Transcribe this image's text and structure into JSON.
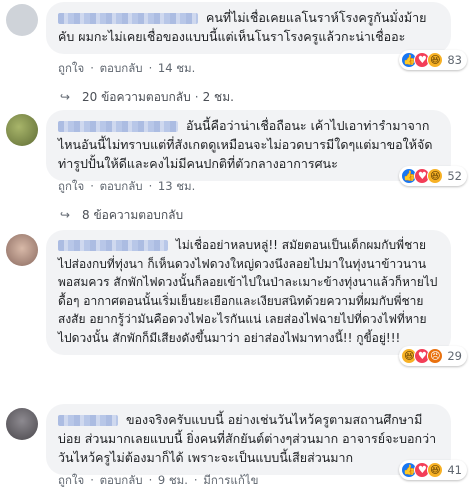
{
  "comments": [
    {
      "text": "คนที่ไม่เชื่อเคยแลโนราห์โรงครูกันมั่งม้ายคับ ผมกะไม่เคยเชื่อของแบบนี้แต่เห็นโนราโรงครูแล้วกะน่าเชื่ออะ",
      "like_label": "ถูกใจ",
      "reply_label": "ตอบกลับ",
      "time": "14 ชม.",
      "reactions": [
        "like",
        "love",
        "haha"
      ],
      "reaction_count": "83",
      "replies": "20 ข้อความตอบกลับ",
      "replies_time": "2 ชม.",
      "avatar_color": "#cfd3d9"
    },
    {
      "text": "อันนี้คือว่าน่าเชื่อถือนะ เค้าไปเอาท่ารำมาจากไหนอันนี้ไม่ทราบแต่ที่สังเกตดูเหมือนจะไม่อวดบารมีใดๆแต่มาขอให้จัดท่ารูปปั้นให้ดีและคงไม่มีคนปกติที่ตัวกลางอาการศนะ",
      "like_label": "ถูกใจ",
      "reply_label": "ตอบกลับ",
      "time": "13 ชม.",
      "reactions": [
        "like",
        "love",
        "haha"
      ],
      "reaction_count": "52",
      "replies": "8 ข้อความตอบกลับ",
      "avatar_color": "#7d8a4e"
    },
    {
      "text": "ไม่เชื่ออย่าหลบหลู่!! สมัยตอนเป็นเด็กผมกับพี่ชาย ไปส่องกบที่ทุ่งนา ก็เห็นดวงไฟดวงใหญ่ดวงนึงลอยไปมาในทุ่งนาข้าวนานพอสมควร สักพักไฟดวงนั้นก็ลอยเข้าไปในป่าละเมาะข้างทุ่งนาแล้วก็หายไปดื้อๆ อากาศตอนนั้นเริ่มเย็นยะเยือกและเงียบสนิทด้วยความที่ผมกับพี่ชายสงสัย อยากรู้ว่ามันคือดวงไฟอะไรกันแน่ เลยส่องไฟฉายไปที่ดวงไฟที่หายไปดวงนั้น สักพักก็มีเสียงดังขึ้นมาว่า อย่าส่องไฟมาทางนี้!! กูขี้อยู่!!!",
      "reactions": [
        "haha",
        "love",
        "angry"
      ],
      "reaction_count": "29",
      "avatar_color": "#b79a8e"
    },
    {
      "text": "ของจริงครับแบบนี้ อย่างเช่นวันไหว้ครูตามสถานศึกษามีบ่อย ส่วนมากเลยแบบนี้ ยิ่งคนที่สักยันต์ต่างๆส่วนมาก อาจารย์จะบอกว่าวันไหว้ครูไม่ต้องมาก็ได้ เพราะจะเป็นแบบนี้เสียส่วนมาก",
      "like_label": "ถูกใจ",
      "reply_label": "ตอบกลับ",
      "time": "9 ชม.",
      "edited": "มีการแก้ไข",
      "reactions": [
        "like",
        "love",
        "haha"
      ],
      "reaction_count": "41",
      "avatar_color": "#6d6a70"
    }
  ],
  "colors": {
    "bubble": "#f2f3f5",
    "meta": "#606770",
    "like": "#1877f2",
    "love": "#f33e58",
    "haha": "#f7b125"
  }
}
